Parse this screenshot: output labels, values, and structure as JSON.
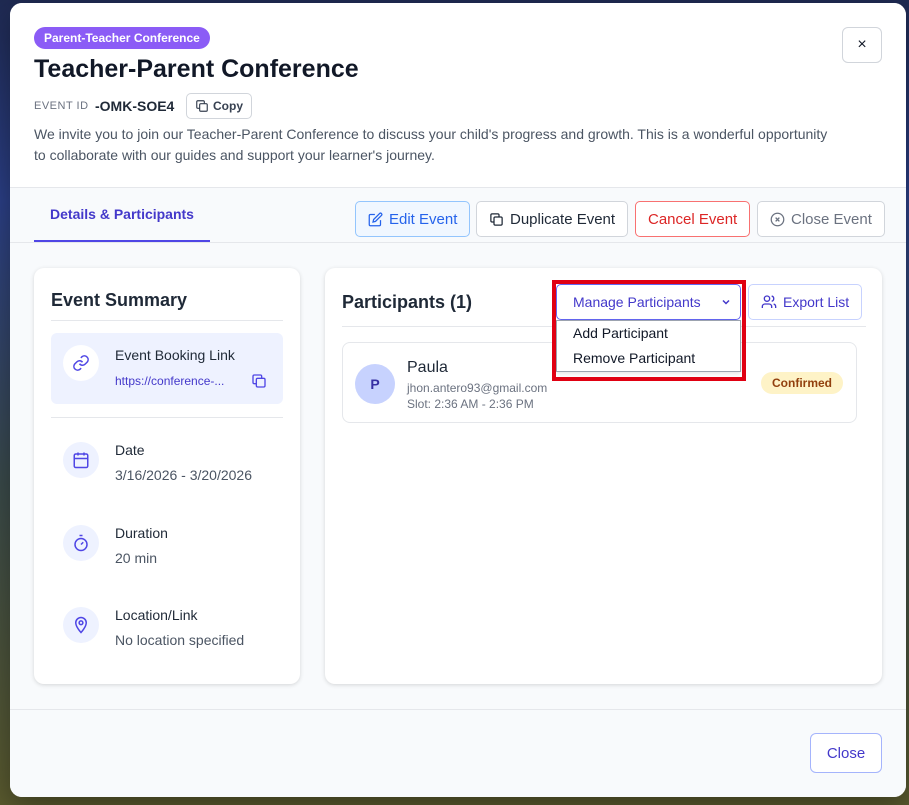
{
  "header": {
    "badge": "Parent-Teacher Conference",
    "title": "Teacher-Parent Conference",
    "event_id_label": "EVENT ID",
    "event_id_value": "-OMK-SOE4",
    "copy_label": "Copy",
    "description": "We invite you to join our Teacher-Parent Conference to discuss your child's progress and growth. This is a wonderful opportunity to collaborate with our guides and support your learner's journey.",
    "close_glyph": "×"
  },
  "tabs": {
    "active": "Details & Participants"
  },
  "actions": {
    "edit": "Edit Event",
    "duplicate": "Duplicate Event",
    "cancel": "Cancel Event",
    "close": "Close Event"
  },
  "summary": {
    "title": "Event Summary",
    "booking_label": "Event Booking Link",
    "booking_link": "https://conference-...",
    "date_label": "Date",
    "date_value": "3/16/2026 - 3/20/2026",
    "duration_label": "Duration",
    "duration_value": "20 min",
    "location_label": "Location/Link",
    "location_value": "No location specified"
  },
  "participants": {
    "title": "Participants (1)",
    "manage_label": "Manage Participants",
    "export_label": "Export List",
    "dropdown_options": [
      "Add Participant",
      "Remove Participant"
    ],
    "list": [
      {
        "initial": "P",
        "name": "Paula",
        "email": "jhon.antero93@gmail.com",
        "slot": "Slot: 2:36 AM - 2:36 PM",
        "status": "Confirmed"
      }
    ]
  },
  "footer": {
    "close_label": "Close"
  },
  "colors": {
    "accent": "#4f46e5",
    "badge": "#8b5cf6",
    "cancel": "#dc2626",
    "highlight": "#e00012",
    "status_bg": "#fef3c7"
  }
}
